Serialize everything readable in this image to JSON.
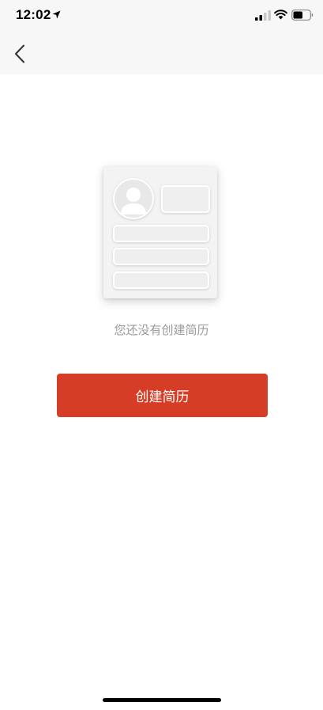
{
  "status_bar": {
    "time": "12:02",
    "icons": [
      "location-arrow-icon",
      "cellular-signal-icon",
      "wifi-icon",
      "battery-icon"
    ]
  },
  "nav": {
    "back_icon": "chevron-left-icon"
  },
  "empty_state": {
    "illustration_icon": "resume-placeholder-icon",
    "message": "您还没有创建简历"
  },
  "actions": {
    "create_resume_label": "创建简历"
  },
  "colors": {
    "accent": "#d63d27",
    "message_text": "#9a9a9a",
    "header_bg": "#f7f7f7"
  }
}
